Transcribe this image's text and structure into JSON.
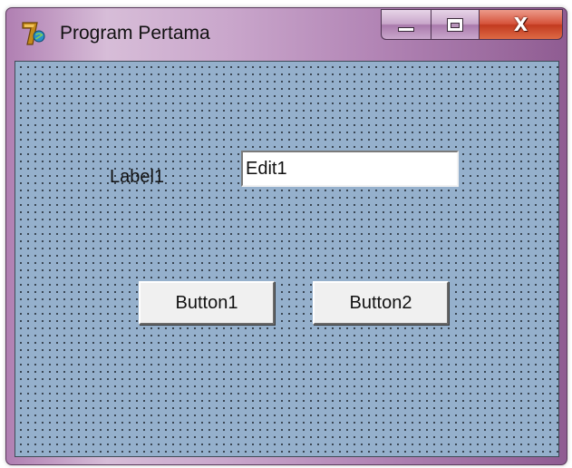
{
  "window": {
    "title": "Program Pertama",
    "icon": "delphi-7-app-icon",
    "caption_buttons": {
      "minimize_icon": "minimize-icon",
      "maximize_icon": "maximize-icon",
      "close_label": "X"
    }
  },
  "form": {
    "background_color": "#95b0cc",
    "grid_dots": true,
    "label1": "Label1",
    "edit1": {
      "value": "Edit1"
    },
    "button1": "Button1",
    "button2": "Button2"
  },
  "colors": {
    "title_frame": "#b386b6",
    "close_button": "#c23a20",
    "form_background": "#95b0cc",
    "button_face": "#f0f0f0"
  }
}
